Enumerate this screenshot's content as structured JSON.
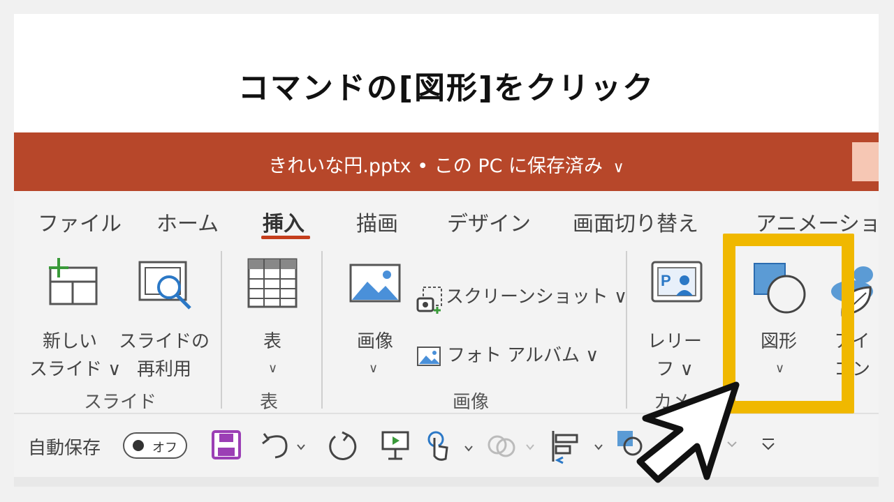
{
  "heading": "コマンドの[図形]をクリック",
  "titlebar": {
    "document": "きれいな円.pptx • この PC に保存済み",
    "chevron": "∨"
  },
  "tabs": [
    "ファイル",
    "ホーム",
    "挿入",
    "描画",
    "デザイン",
    "画面切り替え",
    "アニメーション"
  ],
  "active_tab": "挿入",
  "commands": {
    "new_slide": {
      "line1": "新しい",
      "line2": "スライド ∨"
    },
    "reuse_slide": {
      "line1": "スライドの",
      "line2": "再利用"
    },
    "table": {
      "label": "表",
      "chevron": "∨"
    },
    "image": {
      "label": "画像",
      "chevron": "∨"
    },
    "screenshot": "スクリーンショット ∨",
    "photo_album": "フォト アルバム ∨",
    "relief": {
      "line1": "レリー",
      "line2": "フ ∨"
    },
    "shapes": {
      "label": "図形",
      "chevron": "∨"
    },
    "icons": {
      "line1": "アイ",
      "line2": "コン"
    }
  },
  "groups": {
    "slides": "スライド",
    "table": "表",
    "image": "画像",
    "camera": "カメ"
  },
  "qat": {
    "autosave_label": "自動保存",
    "toggle_state": "オフ"
  },
  "colors": {
    "titlebar": "#b7472a",
    "accent": "#c43e1c",
    "highlight": "#f0b800"
  }
}
